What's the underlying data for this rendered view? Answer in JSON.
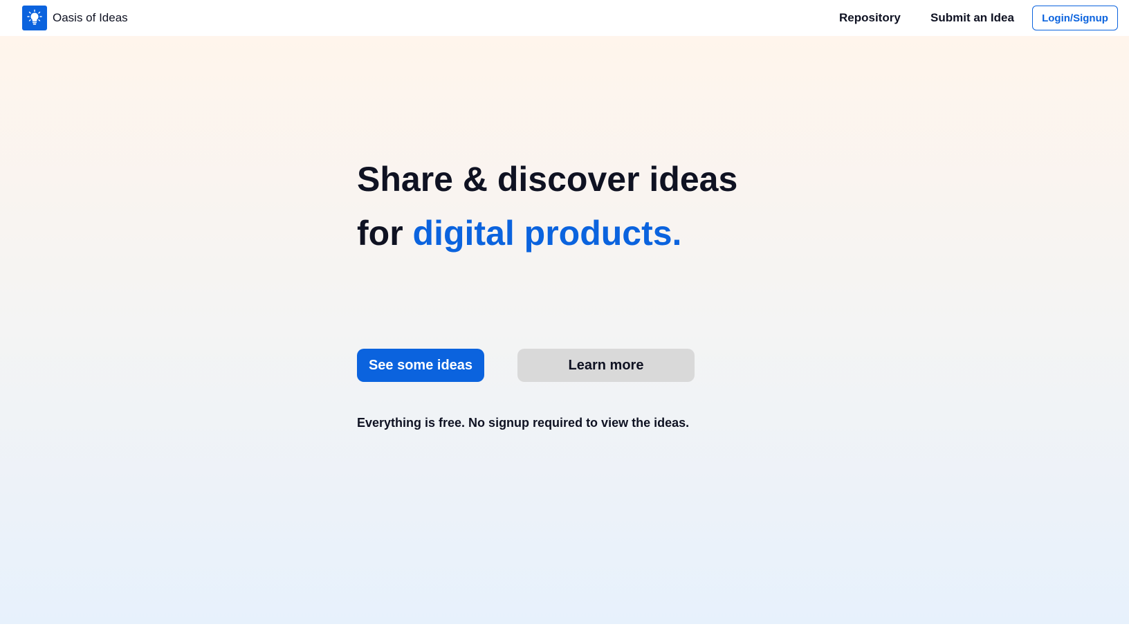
{
  "header": {
    "brand_name": "Oasis of Ideas",
    "logo_icon": "lightbulb-icon",
    "nav": {
      "repository": "Repository",
      "submit": "Submit an Idea"
    },
    "login_label": "Login/Signup"
  },
  "hero": {
    "headline_line1": "Share & discover ideas",
    "headline_for": "for ",
    "headline_accent": "digital products.",
    "primary_button": "See some ideas",
    "secondary_button": "Learn more",
    "note": "Everything is free. No signup required to view the ideas."
  },
  "colors": {
    "accent": "#0b63de",
    "text": "#0f1222",
    "secondary_button_bg": "#d9d9d9"
  }
}
